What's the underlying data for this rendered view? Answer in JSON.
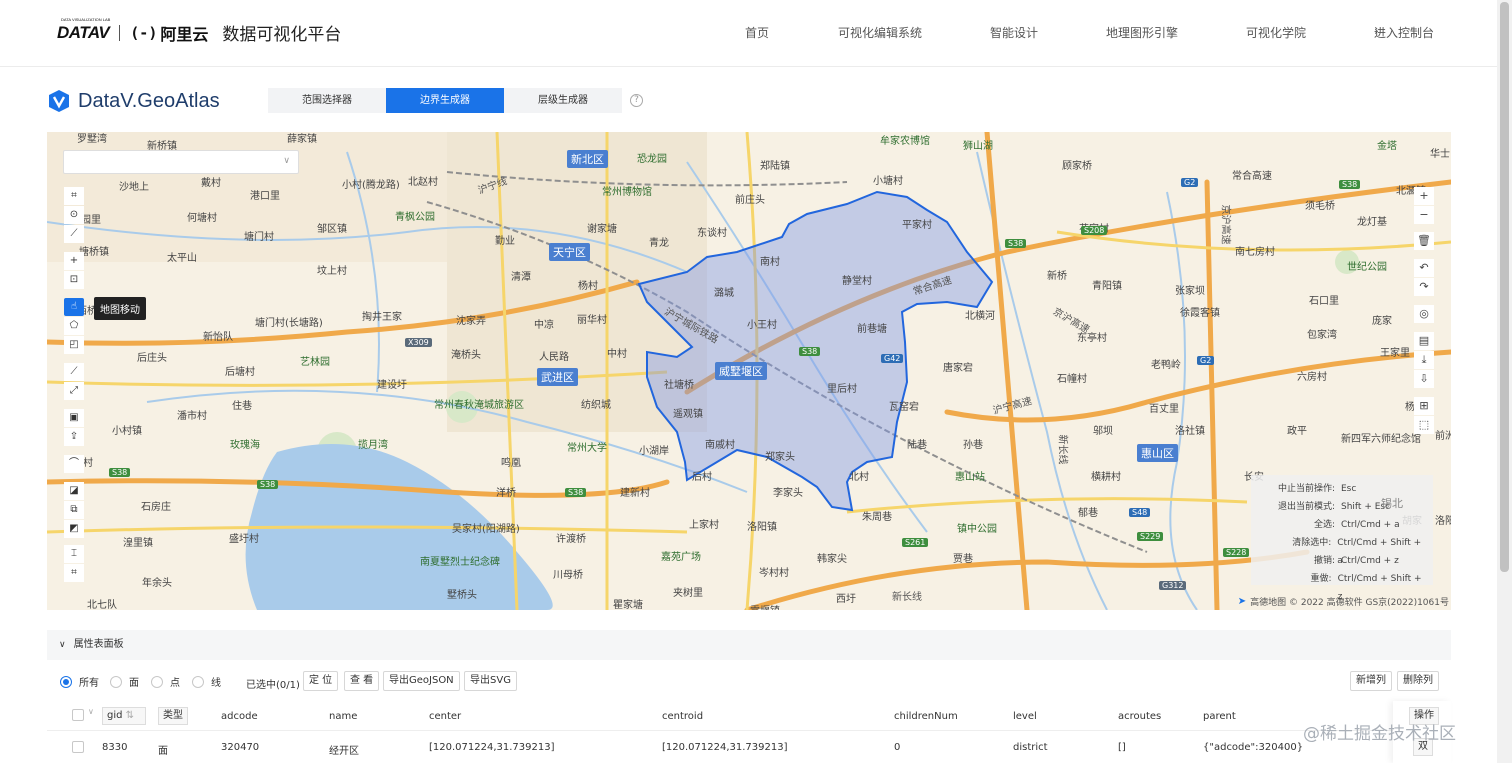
{
  "nav": {
    "brand_small": "DATA VISUALIZATION LAB",
    "datav_logo": "DATAV",
    "aliyun_mark": "(-)",
    "aliyun_text": "阿里云",
    "platform": "数据可视化平台",
    "links": [
      "首页",
      "可视化编辑系统",
      "智能设计",
      "地理图形引擎",
      "可视化学院",
      "进入控制台"
    ],
    "chevron": "›"
  },
  "app": {
    "title": "DataV.GeoAtlas",
    "tabs": [
      "范围选择器",
      "边界生成器",
      "层级生成器"
    ],
    "active_tab": "边界生成器",
    "help": "?"
  },
  "map": {
    "select_placeholder": "",
    "tooltip": "地图移动",
    "left_tools": [
      "rect-select-icon",
      "circle-select-icon",
      "lasso-icon",
      "add-point-icon",
      "point-select-icon",
      "hand-icon",
      "polygon-icon",
      "box-icon",
      "line-icon",
      "measure-icon",
      "text-icon",
      "export-icon",
      "curve-icon",
      "merge-icon",
      "union-icon",
      "diff-icon",
      "split-icon",
      "crop-icon"
    ],
    "right_tools": [
      "zoom-in-icon",
      "zoom-out-icon",
      "delete-icon",
      "undo-icon",
      "redo-icon",
      "locate-icon",
      "file-icon",
      "download-icon",
      "save-icon",
      "fullscreen-icon",
      "layer-icon"
    ],
    "shortcuts": [
      {
        "key": "中止当前操作:",
        "value": "Esc"
      },
      {
        "key": "退出当前模式:",
        "value": "Shift + Esc"
      },
      {
        "key": "全选:",
        "value": "Ctrl/Cmd + a"
      },
      {
        "key": "清除选中:",
        "value": "Ctrl/Cmd + Shift + a"
      },
      {
        "key": "撤销:",
        "value": "Ctrl/Cmd + z"
      },
      {
        "key": "重做:",
        "value": "Ctrl/Cmd + Shift + z"
      }
    ],
    "shortcut_bg_text": "锡北",
    "amap": "高德地图",
    "copyright": "© 2022 高德软件 GS京(2022)1061号",
    "districts": [
      "新北区",
      "天宁区",
      "武进区",
      "威墅堰区",
      "惠山区"
    ],
    "places": [
      "罗墅湾",
      "新桥镇",
      "薛家镇",
      "恐龙园",
      "郑陆镇",
      "牟家农博馆",
      "狮山湖",
      "金塔",
      "华士",
      "沙地上",
      "戴村",
      "港口里",
      "北赵村",
      "小村(腾龙路)",
      "常州博物馆",
      "前庄头",
      "小塘村",
      "顾家桥",
      "常合高速",
      "北漍镇",
      "杨园里",
      "何塘村",
      "青枫公园",
      "谢家塘",
      "平家村",
      "京沪高速",
      "龙灯基",
      "须毛桥",
      "塘桥镇",
      "太平山",
      "邹区镇",
      "塘门村",
      "勤业",
      "东谈村",
      "青龙",
      "南村",
      "静堂村",
      "花家村",
      "南七房村",
      "世纪公园",
      "坟上村",
      "清潭",
      "杨村",
      "潞城",
      "青阳镇",
      "张家坝",
      "石口里",
      "西桥",
      "新桥",
      "掏井王家",
      "沈家弄",
      "中凉",
      "丽华村",
      "小王村",
      "北横河",
      "徐霞客镇",
      "庞家",
      "新怡队",
      "塘门村(长塘路)",
      "艺林园",
      "淹桥头",
      "人民路",
      "中村",
      "前巷塘",
      "东亭村",
      "包家湾",
      "后庄头",
      "后塘村",
      "建设圩",
      "社塘桥",
      "唐家宕",
      "老鸭岭",
      "王家里",
      "常州春秋淹城旅游区",
      "纺织城",
      "里后村",
      "石幢村",
      "六房村",
      "小村镇",
      "潘市村",
      "住巷",
      "遥观镇",
      "瓦窑宕",
      "百丈里",
      "杨",
      "政平",
      "玫瑰海",
      "揽月湾",
      "常州大学",
      "小湖岸",
      "南戚村",
      "陆巷",
      "孙巷",
      "邬坝",
      "洛社镇",
      "新四军六师纪念馆",
      "后村",
      "郑家头",
      "北村",
      "惠山站",
      "横耕村",
      "长安",
      "殷村",
      "鸣凰",
      "洋桥",
      "建新村",
      "李家头",
      "朱周巷",
      "郁巷",
      "石房庄",
      "上家村",
      "吴家村(阳湖路)",
      "洛阳镇",
      "镇中公园",
      "盛圩村",
      "许渡桥",
      "湟里镇",
      "南夏墅烈士纪念碑",
      "嘉苑广场",
      "韩家尖",
      "贾巷",
      "年余头",
      "川母桥",
      "岑村村",
      "墅桥头",
      "瞿家塘",
      "夹树里",
      "西圩",
      "新长线",
      "北七队",
      "雪堰镇",
      "胡家",
      "前洲",
      "洛阳"
    ],
    "roads": [
      "沪宁线",
      "沪宁城际铁路",
      "京沪高速",
      "常合高速",
      "沪宁高速",
      "新长线",
      "S38",
      "G42",
      "S208",
      "X309",
      "S261",
      "S229",
      "S228",
      "G2",
      "S48",
      "G312"
    ]
  },
  "panel": {
    "title": "属性表面板",
    "caret": "∨",
    "filters": [
      "所有",
      "面",
      "点",
      "线"
    ],
    "selected": "已选中(0/1)",
    "buttons": [
      "定 位",
      "查 看",
      "导出GeoJSON",
      "导出SVG"
    ],
    "right_buttons": [
      "新增列",
      "删除列"
    ],
    "columns": [
      "gid",
      "类型",
      "adcode",
      "name",
      "center",
      "centroid",
      "childrenNum",
      "level",
      "acroutes",
      "parent",
      "操作"
    ],
    "sort_icon": "⇅",
    "rows": [
      {
        "gid": "8330",
        "type": "面",
        "adcode": "320470",
        "name": "经开区",
        "center": "[120.071224,31.739213]",
        "centroid": "[120.071224,31.739213]",
        "childrenNum": "0",
        "level": "district",
        "acroutes": "[]",
        "parent": "{\"adcode\":320400}",
        "op": "双"
      }
    ]
  },
  "watermark": "@稀土掘金技术社区"
}
